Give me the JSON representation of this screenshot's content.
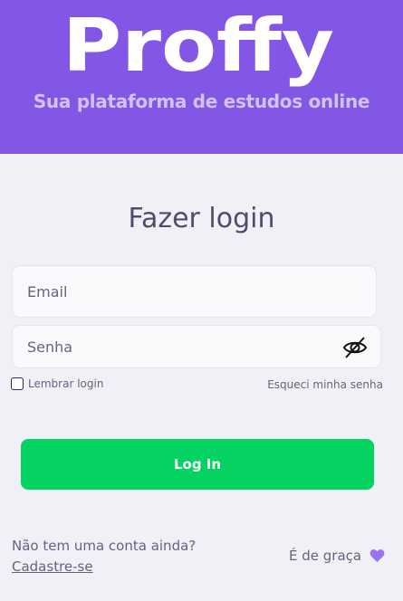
{
  "brand": {
    "logo_text": "Proffy",
    "tagline": "Sua plataforma de estudos online"
  },
  "login": {
    "title": "Fazer login",
    "email_placeholder": "Email",
    "password_placeholder": "Senha",
    "toggle_icon": "eye-slash-icon",
    "remember_label": "Lembrar login",
    "remember_checked": false,
    "forgot_label": "Esqueci minha senha",
    "submit_label": "Log In"
  },
  "footer": {
    "no_account": "Não tem uma conta ainda?",
    "signup_label": "Cadastre-se",
    "free_label": "É de graça",
    "free_icon": "heart-icon"
  },
  "colors": {
    "brand_purple": "#8257e5",
    "tagline": "#d4c2ff",
    "background": "#f0f0f7",
    "button_green": "#04d361",
    "heart": "#9871f5"
  }
}
